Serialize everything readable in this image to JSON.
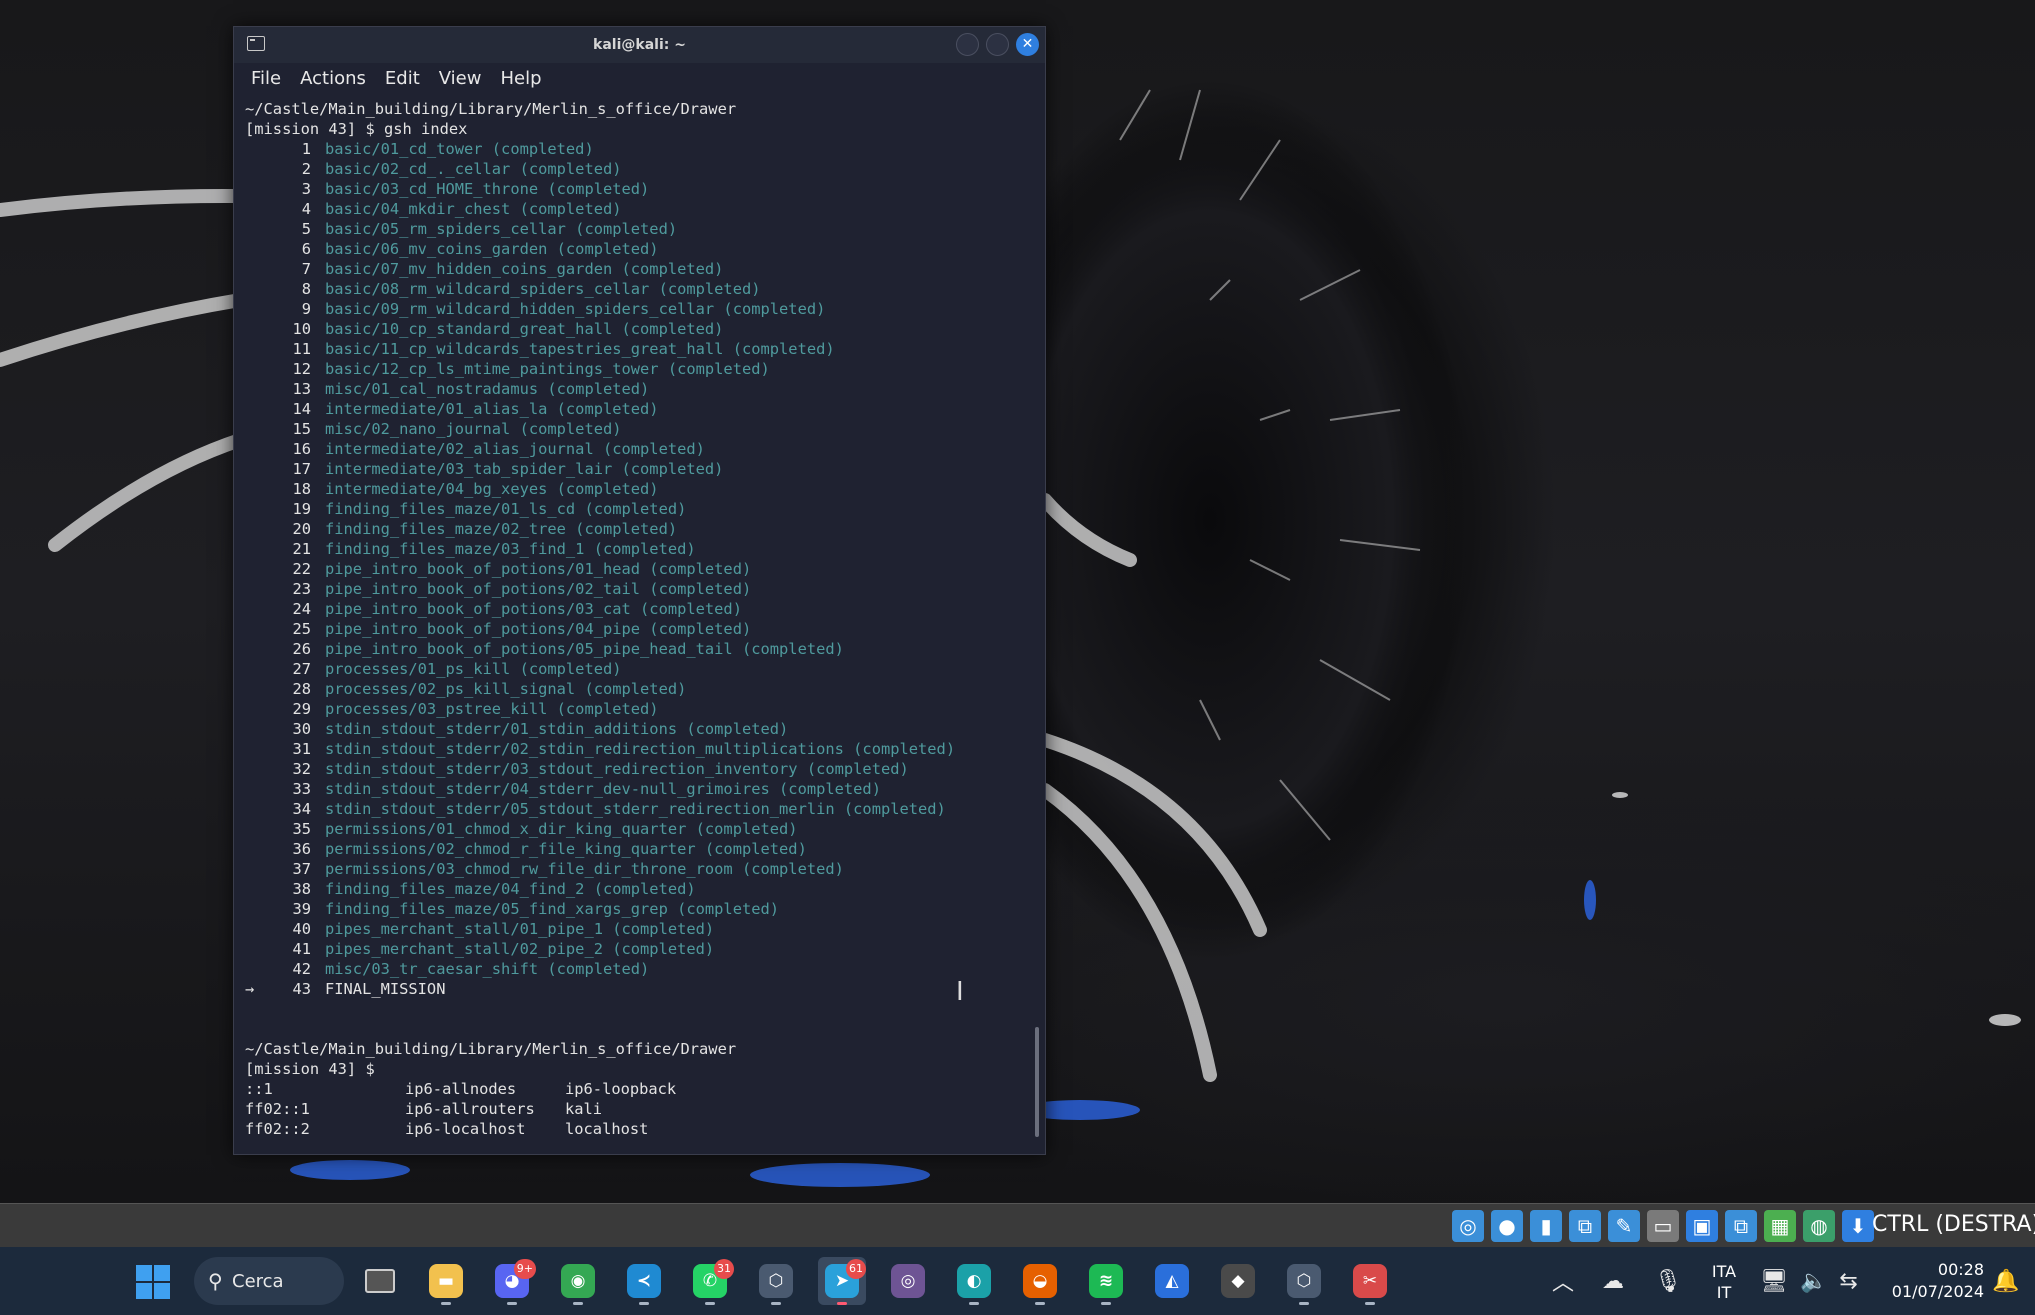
{
  "window": {
    "title": "kali@kali: ~",
    "menu": [
      "File",
      "Actions",
      "Edit",
      "View",
      "Help"
    ]
  },
  "terminal": {
    "header_path": "~/Castle/Main_building/Library/Merlin_s_office/Drawer",
    "header_prompt": "[mission 43] $ gsh index",
    "tasks": [
      {
        "n": "1",
        "text": "basic/01_cd_tower (completed)"
      },
      {
        "n": "2",
        "text": "basic/02_cd_._cellar (completed)"
      },
      {
        "n": "3",
        "text": "basic/03_cd_HOME_throne (completed)"
      },
      {
        "n": "4",
        "text": "basic/04_mkdir_chest (completed)"
      },
      {
        "n": "5",
        "text": "basic/05_rm_spiders_cellar (completed)"
      },
      {
        "n": "6",
        "text": "basic/06_mv_coins_garden (completed)"
      },
      {
        "n": "7",
        "text": "basic/07_mv_hidden_coins_garden (completed)"
      },
      {
        "n": "8",
        "text": "basic/08_rm_wildcard_spiders_cellar (completed)"
      },
      {
        "n": "9",
        "text": "basic/09_rm_wildcard_hidden_spiders_cellar (completed)"
      },
      {
        "n": "10",
        "text": "basic/10_cp_standard_great_hall (completed)"
      },
      {
        "n": "11",
        "text": "basic/11_cp_wildcards_tapestries_great_hall (completed)"
      },
      {
        "n": "12",
        "text": "basic/12_cp_ls_mtime_paintings_tower (completed)"
      },
      {
        "n": "13",
        "text": "misc/01_cal_nostradamus (completed)"
      },
      {
        "n": "14",
        "text": "intermediate/01_alias_la (completed)"
      },
      {
        "n": "15",
        "text": "misc/02_nano_journal (completed)"
      },
      {
        "n": "16",
        "text": "intermediate/02_alias_journal (completed)"
      },
      {
        "n": "17",
        "text": "intermediate/03_tab_spider_lair (completed)"
      },
      {
        "n": "18",
        "text": "intermediate/04_bg_xeyes (completed)"
      },
      {
        "n": "19",
        "text": "finding_files_maze/01_ls_cd (completed)"
      },
      {
        "n": "20",
        "text": "finding_files_maze/02_tree (completed)"
      },
      {
        "n": "21",
        "text": "finding_files_maze/03_find_1 (completed)"
      },
      {
        "n": "22",
        "text": "pipe_intro_book_of_potions/01_head (completed)"
      },
      {
        "n": "23",
        "text": "pipe_intro_book_of_potions/02_tail (completed)"
      },
      {
        "n": "24",
        "text": "pipe_intro_book_of_potions/03_cat (completed)"
      },
      {
        "n": "25",
        "text": "pipe_intro_book_of_potions/04_pipe (completed)"
      },
      {
        "n": "26",
        "text": "pipe_intro_book_of_potions/05_pipe_head_tail (completed)"
      },
      {
        "n": "27",
        "text": "processes/01_ps_kill (completed)"
      },
      {
        "n": "28",
        "text": "processes/02_ps_kill_signal (completed)"
      },
      {
        "n": "29",
        "text": "processes/03_pstree_kill (completed)"
      },
      {
        "n": "30",
        "text": "stdin_stdout_stderr/01_stdin_additions (completed)"
      },
      {
        "n": "31",
        "text": "stdin_stdout_stderr/02_stdin_redirection_multiplications (completed)"
      },
      {
        "n": "32",
        "text": "stdin_stdout_stderr/03_stdout_redirection_inventory (completed)"
      },
      {
        "n": "33",
        "text": "stdin_stdout_stderr/04_stderr_dev-null_grimoires (completed)"
      },
      {
        "n": "34",
        "text": "stdin_stdout_stderr/05_stdout_stderr_redirection_merlin (completed)"
      },
      {
        "n": "35",
        "text": "permissions/01_chmod_x_dir_king_quarter (completed)"
      },
      {
        "n": "36",
        "text": "permissions/02_chmod_r_file_king_quarter (completed)"
      },
      {
        "n": "37",
        "text": "permissions/03_chmod_rw_file_dir_throne_room (completed)"
      },
      {
        "n": "38",
        "text": "finding_files_maze/04_find_2 (completed)"
      },
      {
        "n": "39",
        "text": "finding_files_maze/05_find_xargs_grep (completed)"
      },
      {
        "n": "40",
        "text": "pipes_merchant_stall/01_pipe_1 (completed)"
      },
      {
        "n": "41",
        "text": "pipes_merchant_stall/02_pipe_2 (completed)"
      },
      {
        "n": "42",
        "text": "misc/03_tr_caesar_shift (completed)"
      }
    ],
    "current_arrow": "→",
    "current_n": "43",
    "current_text": "FINAL_MISSION",
    "footer_path": "~/Castle/Main_building/Library/Merlin_s_office/Drawer",
    "footer_prompt": "[mission 43] $",
    "hosts": [
      [
        "::1",
        "ip6-allnodes",
        "ip6-loopback"
      ],
      [
        "ff02::1",
        "ip6-allrouters",
        "kali"
      ],
      [
        "ff02::2",
        "ip6-localhost",
        "localhost"
      ]
    ]
  },
  "vbox": {
    "host_key": "CTRL (DESTRA)",
    "icons": [
      "hard-disk-icon",
      "optical-drive-icon",
      "audio-icon",
      "network-icon",
      "usb-icon",
      "shared-folder-icon",
      "display-icon",
      "recording-icon",
      "cpu-icon",
      "mouse-integration-icon",
      "download-icon"
    ]
  },
  "taskbar": {
    "search_label": "Cerca",
    "apps": [
      {
        "name": "file-explorer-icon",
        "color": "#f2c14e",
        "glyph": "▬",
        "badge": ""
      },
      {
        "name": "discord-icon",
        "color": "#5865f2",
        "glyph": "◕",
        "badge": "9+"
      },
      {
        "name": "chrome-icon",
        "color": "#34a853",
        "glyph": "◉",
        "badge": ""
      },
      {
        "name": "vscode-icon",
        "color": "#1f8ad2",
        "glyph": "≺",
        "badge": ""
      },
      {
        "name": "whatsapp-icon",
        "color": "#25d366",
        "glyph": "✆",
        "badge": "31"
      },
      {
        "name": "virtualbox-cube-icon",
        "color": "#4a5a70",
        "glyph": "⬡",
        "badge": ""
      },
      {
        "name": "telegram-icon",
        "color": "#2aa1da",
        "glyph": "➤",
        "badge": "61"
      },
      {
        "name": "github-icon",
        "color": "#6e5494",
        "glyph": "◎",
        "badge": ""
      },
      {
        "name": "edge-icon",
        "color": "#1ba1a8",
        "glyph": "◐",
        "badge": ""
      },
      {
        "name": "firefox-icon",
        "color": "#e66000",
        "glyph": "◒",
        "badge": ""
      },
      {
        "name": "spotify-icon",
        "color": "#1db954",
        "glyph": "≋",
        "badge": ""
      },
      {
        "name": "kali-icon",
        "color": "#2a6fdb",
        "glyph": "◭",
        "badge": ""
      },
      {
        "name": "unity-icon",
        "color": "#4a4a4a",
        "glyph": "◆",
        "badge": ""
      },
      {
        "name": "virtualbox-icon",
        "color": "#4a5a70",
        "glyph": "⬡",
        "badge": ""
      },
      {
        "name": "snipping-tool-icon",
        "color": "#d94a4a",
        "glyph": "✂",
        "badge": ""
      }
    ],
    "lang_1": "ITA",
    "lang_2": "IT",
    "time": "00:28",
    "date": "01/07/2024"
  }
}
